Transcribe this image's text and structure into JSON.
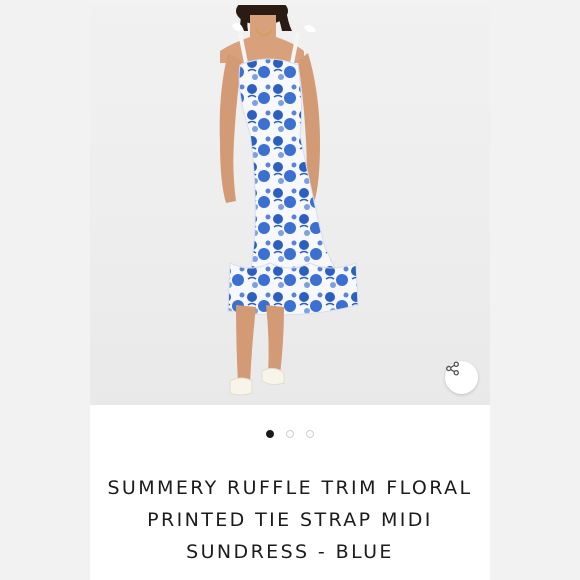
{
  "product": {
    "title": "SUMMERY RUFFLE TRIM FLORAL PRINTED TIE STRAP MIDI SUNDRESS - BLUE",
    "image_count": 3,
    "active_image_index": 0
  },
  "icons": {
    "share": "share-icon"
  },
  "colors": {
    "print_blue": "#2d5fbf",
    "dress_white": "#f7f8fc",
    "active_dot": "#1a1a1a",
    "inactive_dot_border": "#cfcfcf"
  }
}
